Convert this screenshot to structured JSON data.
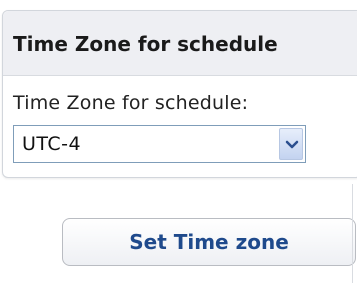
{
  "panel": {
    "title": "Time Zone for schedule"
  },
  "form": {
    "timezone_label": "Time Zone for schedule:",
    "timezone_selected": "UTC-4",
    "dropdown_icon": "chevron-down-icon"
  },
  "actions": {
    "set_button_label": "Set Time zone"
  },
  "colors": {
    "header_bg": "#eeeff3",
    "button_text": "#1f4a8c",
    "select_border": "#7f9db9"
  }
}
